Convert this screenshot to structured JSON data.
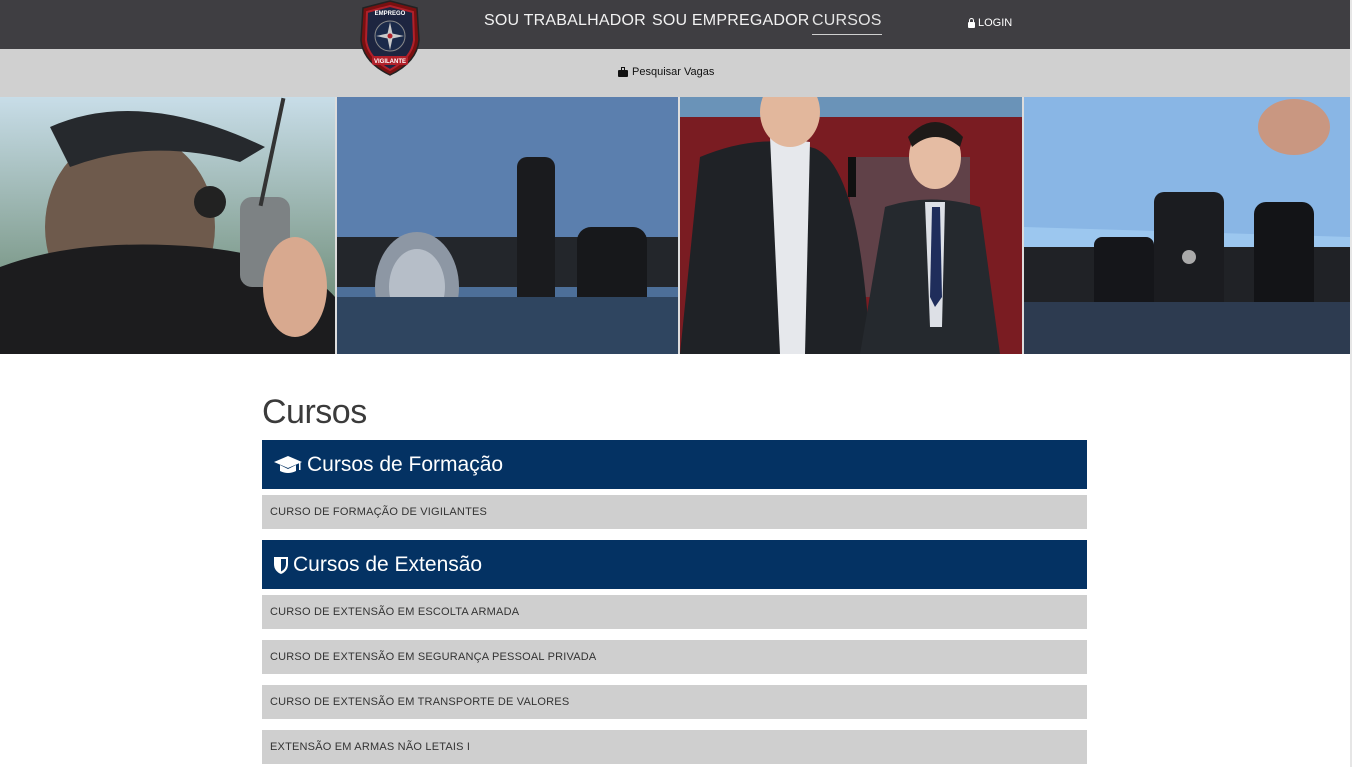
{
  "nav": {
    "worker": "SOU TRABALHADOR",
    "employer": "SOU EMPREGADOR",
    "courses": "CURSOS",
    "login": "LOGIN"
  },
  "logo": {
    "top_text": "EMPREGO",
    "bottom_text": "VIGILANTE"
  },
  "subnav": {
    "search_jobs": "Pesquisar Vagas"
  },
  "page": {
    "title": "Cursos"
  },
  "sections": [
    {
      "title": "Cursos de Formação",
      "icon": "graduation-cap-icon",
      "items": [
        "CURSO DE FORMAÇÃO DE VIGILANTES"
      ]
    },
    {
      "title": "Cursos de Extensão",
      "icon": "shield-icon",
      "items": [
        "CURSO DE EXTENSÃO EM ESCOLTA ARMADA",
        "CURSO DE EXTENSÃO EM SEGURANÇA PESSOAL PRIVADA",
        "CURSO DE EXTENSÃO EM TRANSPORTE DE VALORES",
        "EXTENSÃO EM ARMAS NÃO LETAIS I"
      ]
    }
  ],
  "colors": {
    "topbar": "#3f3e42",
    "subbar": "#d0d0d0",
    "section_header": "#043263",
    "course_item": "#cfcfcf"
  }
}
